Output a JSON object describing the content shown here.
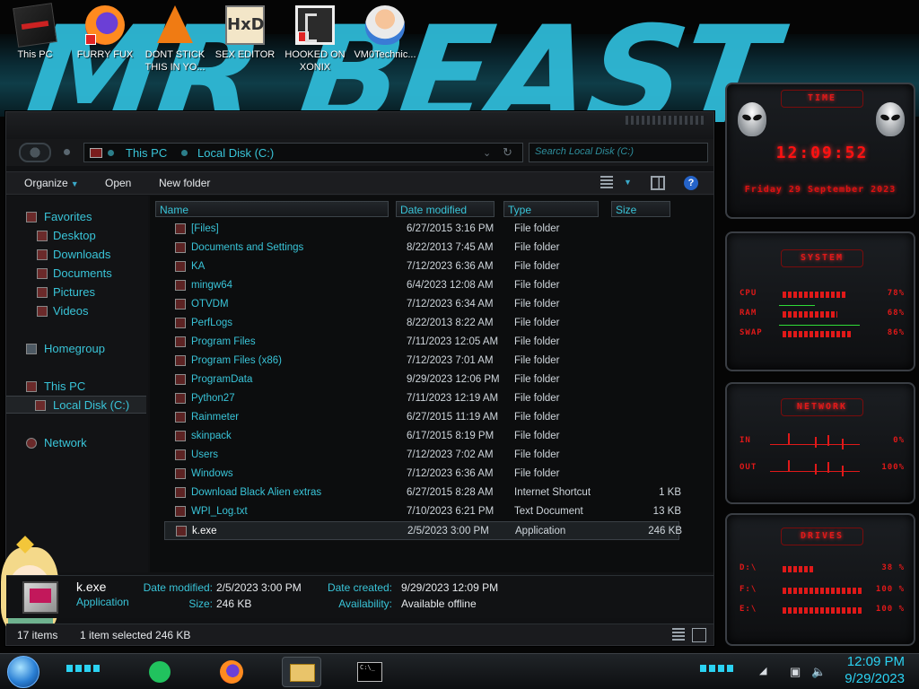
{
  "desktop": {
    "icons": [
      {
        "label": "This PC",
        "icon": "this-pc-icon"
      },
      {
        "label": "FURRY FUX",
        "icon": "firefox-icon"
      },
      {
        "label": "DONT STICK THIS IN YO...",
        "icon": "vlc-cone-icon"
      },
      {
        "label": "SEX EDITOR",
        "icon": "hex-editor-icon"
      },
      {
        "label": "HOOKED ON XONIX",
        "icon": "maze-game-icon"
      },
      {
        "label": "VM0Technic...",
        "icon": "doctor-icon"
      }
    ]
  },
  "explorer": {
    "address": {
      "crumbs": [
        "This PC",
        "Local Disk (C:)"
      ]
    },
    "search_placeholder": "Search Local Disk (C:)",
    "commands": {
      "organize": "Organize",
      "open": "Open",
      "new_folder": "New folder"
    },
    "nav": {
      "favorites": "Favorites",
      "desktop": "Desktop",
      "downloads": "Downloads",
      "documents": "Documents",
      "pictures": "Pictures",
      "videos": "Videos",
      "homegroup": "Homegroup",
      "this_pc": "This PC",
      "local_disk": "Local Disk (C:)",
      "network": "Network"
    },
    "columns": {
      "name": "Name",
      "date": "Date modified",
      "type": "Type",
      "size": "Size"
    },
    "files": [
      {
        "name": "[Files]",
        "date": "6/27/2015 3:16 PM",
        "type": "File folder",
        "size": ""
      },
      {
        "name": "Documents and Settings",
        "date": "8/22/2013 7:45 AM",
        "type": "File folder",
        "size": ""
      },
      {
        "name": "KA",
        "date": "7/12/2023 6:36 AM",
        "type": "File folder",
        "size": ""
      },
      {
        "name": "mingw64",
        "date": "6/4/2023 12:08 AM",
        "type": "File folder",
        "size": ""
      },
      {
        "name": "OTVDM",
        "date": "7/12/2023 6:34 AM",
        "type": "File folder",
        "size": ""
      },
      {
        "name": "PerfLogs",
        "date": "8/22/2013 8:22 AM",
        "type": "File folder",
        "size": ""
      },
      {
        "name": "Program Files",
        "date": "7/11/2023 12:05 AM",
        "type": "File folder",
        "size": ""
      },
      {
        "name": "Program Files (x86)",
        "date": "7/12/2023 7:01 AM",
        "type": "File folder",
        "size": ""
      },
      {
        "name": "ProgramData",
        "date": "9/29/2023 12:06 PM",
        "type": "File folder",
        "size": ""
      },
      {
        "name": "Python27",
        "date": "7/11/2023 12:19 AM",
        "type": "File folder",
        "size": ""
      },
      {
        "name": "Rainmeter",
        "date": "6/27/2015 11:19 AM",
        "type": "File folder",
        "size": ""
      },
      {
        "name": "skinpack",
        "date": "6/17/2015 8:19 PM",
        "type": "File folder",
        "size": ""
      },
      {
        "name": "Users",
        "date": "7/12/2023 7:02 AM",
        "type": "File folder",
        "size": ""
      },
      {
        "name": "Windows",
        "date": "7/12/2023 6:36 AM",
        "type": "File folder",
        "size": ""
      },
      {
        "name": "Download Black Alien extras",
        "date": "6/27/2015 8:28 AM",
        "type": "Internet Shortcut",
        "size": "1 KB"
      },
      {
        "name": "WPI_Log.txt",
        "date": "7/10/2023 6:21 PM",
        "type": "Text Document",
        "size": "13 KB"
      },
      {
        "name": "k.exe",
        "date": "2/5/2023 3:00 PM",
        "type": "Application",
        "size": "246 KB"
      }
    ],
    "details": {
      "name": "k.exe",
      "type": "Application",
      "date_modified_label": "Date modified:",
      "date_modified": "2/5/2023 3:00 PM",
      "size_label": "Size:",
      "size": "246 KB",
      "date_created_label": "Date created:",
      "date_created": "9/29/2023 12:09 PM",
      "availability_label": "Availability:",
      "availability": "Available offline"
    },
    "status": {
      "items": "17 items",
      "selected": "1 item selected  246 KB"
    }
  },
  "gadgets": {
    "time_title": "TIME",
    "clock": "12:09:52",
    "date": "Friday 29 September 2023",
    "system_title": "SYSTEM",
    "cpu": {
      "label": "CPU",
      "value": "78%",
      "level": 0.78
    },
    "ram": {
      "label": "RAM",
      "value": "68%",
      "level": 0.68
    },
    "swap": {
      "label": "SWAP",
      "value": "86%",
      "level": 0.86
    },
    "network_title": "NETWORK",
    "net_in": {
      "label": "IN",
      "value": "0%"
    },
    "net_out": {
      "label": "OUT",
      "value": "100%"
    },
    "drives_title": "DRIVES",
    "drives": [
      {
        "label": "D:\\",
        "value": "38 %",
        "level": 0.38
      },
      {
        "label": "F:\\",
        "value": "100 %",
        "level": 1.0
      },
      {
        "label": "E:\\",
        "value": "100 %",
        "level": 1.0
      }
    ]
  },
  "taskbar": {
    "time": "12:09 PM",
    "date": "9/29/2023",
    "apps": [
      "sheets-icon",
      "firefox-icon",
      "file-explorer-icon",
      "command-prompt-icon"
    ]
  },
  "colors": {
    "accent_cyan": "#39c4d8",
    "gadget_red": "#e01919",
    "background": "#0a0a0c"
  }
}
